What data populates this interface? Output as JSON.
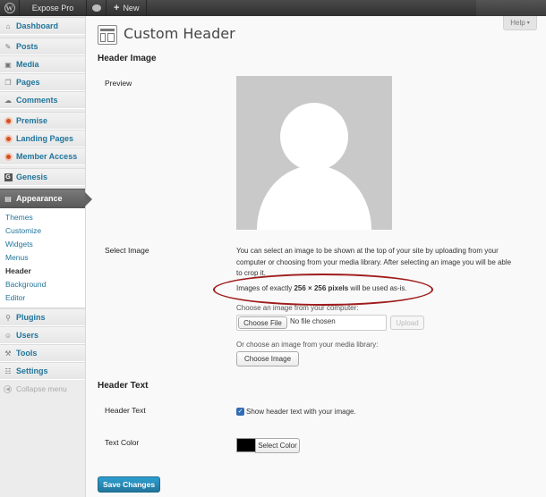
{
  "admin_bar": {
    "site_name": "Expose Pro",
    "new_label": "New"
  },
  "sidebar": {
    "items": [
      {
        "label": "Dashboard",
        "icon": "home-icon"
      },
      {
        "label": "Posts",
        "icon": "pin-icon"
      },
      {
        "label": "Media",
        "icon": "media-icon"
      },
      {
        "label": "Pages",
        "icon": "pages-icon"
      },
      {
        "label": "Comments",
        "icon": "comment-icon"
      },
      {
        "label": "Premise",
        "icon": "premise-icon"
      },
      {
        "label": "Landing Pages",
        "icon": "landing-icon"
      },
      {
        "label": "Member Access",
        "icon": "member-icon"
      },
      {
        "label": "Genesis",
        "icon": "genesis-icon"
      },
      {
        "label": "Appearance",
        "icon": "appearance-icon"
      },
      {
        "label": "Plugins",
        "icon": "plugin-icon"
      },
      {
        "label": "Users",
        "icon": "users-icon"
      },
      {
        "label": "Tools",
        "icon": "tools-icon"
      },
      {
        "label": "Settings",
        "icon": "settings-icon"
      }
    ],
    "appearance_submenu": [
      "Themes",
      "Customize",
      "Widgets",
      "Menus",
      "Header",
      "Background",
      "Editor"
    ],
    "collapse_label": "Collapse menu"
  },
  "help_label": "Help",
  "page_title": "Custom Header",
  "header_image": {
    "section_title": "Header Image",
    "preview_label": "Preview",
    "select_label": "Select Image",
    "description": "You can select an image to be shown at the top of your site by uploading from your computer or choosing from your media library. After selecting an image you will be able to crop it.",
    "exact_prefix": "Images of exactly ",
    "exact_size": "256 × 256 pixels",
    "exact_suffix": " will be used as-is.",
    "upload_label": "Choose an image from your computer:",
    "choose_file_label": "Choose File",
    "no_file_text": "No file chosen",
    "upload_button": "Upload",
    "library_label": "Or choose an image from your media library:",
    "choose_image_button": "Choose Image"
  },
  "header_text": {
    "section_title": "Header Text",
    "header_text_label": "Header Text",
    "show_text_label": "Show header text with your image.",
    "show_text_checked": true,
    "text_color_label": "Text Color",
    "select_color_button": "Select Color",
    "color_value": "#000000"
  },
  "save_button": "Save Changes",
  "colors": {
    "link": "#21759b",
    "highlight_ellipse": "#9e1b1b"
  }
}
